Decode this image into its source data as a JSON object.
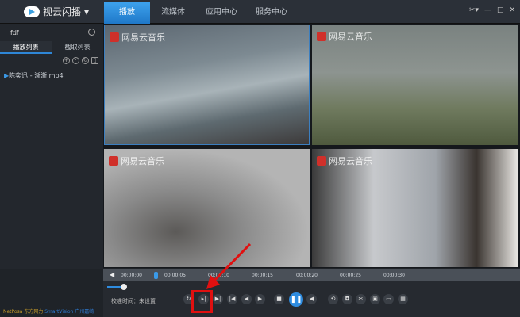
{
  "app": {
    "title": "视云闪播"
  },
  "tabs": [
    "播放",
    "流媒体",
    "应用中心",
    "服务中心"
  ],
  "window_controls": [
    "✂▾",
    "—",
    "□",
    "✕"
  ],
  "sidebar": {
    "search_value": "fdf",
    "tabs": [
      "播放列表",
      "截取列表"
    ],
    "files": [
      "陈奕迅 - 渐渐.mp4"
    ]
  },
  "watermark": "网易云音乐",
  "timeline": {
    "ticks": [
      "00:00:00",
      "00:00:05",
      "00:00:10",
      "00:00:15",
      "00:00:20",
      "00:00:25",
      "00:00:30"
    ]
  },
  "controls": {
    "calibration_label": "校准时间：未设置"
  },
  "brand": {
    "a": "NetPosa 东方网力",
    "b": "SmartVision 广州嘉崎"
  },
  "colors": {
    "accent": "#2e8ce0",
    "highlight": "#e01010"
  }
}
